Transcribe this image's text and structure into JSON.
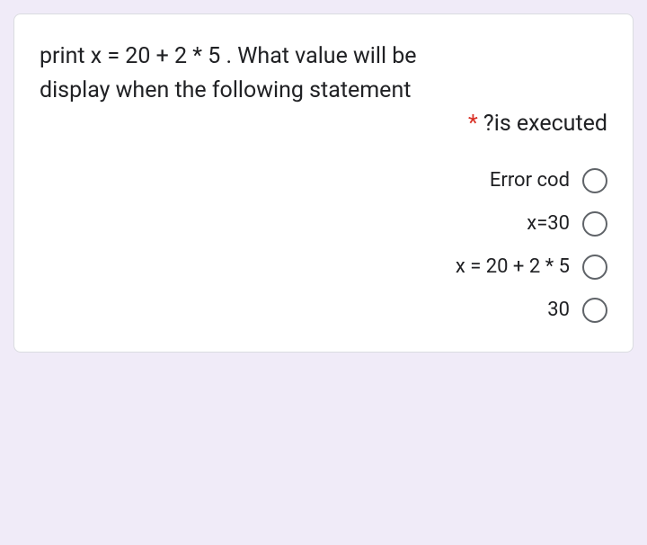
{
  "question": {
    "line1": "print x = 20 + 2 * 5 . What value will be",
    "line2": "display when the following statement",
    "line3_end": "?is executed",
    "required_marker": "*"
  },
  "options": [
    {
      "label": "Error cod"
    },
    {
      "label": "x=30"
    },
    {
      "label": "x = 20 + 2 * 5"
    },
    {
      "label": "30"
    }
  ]
}
